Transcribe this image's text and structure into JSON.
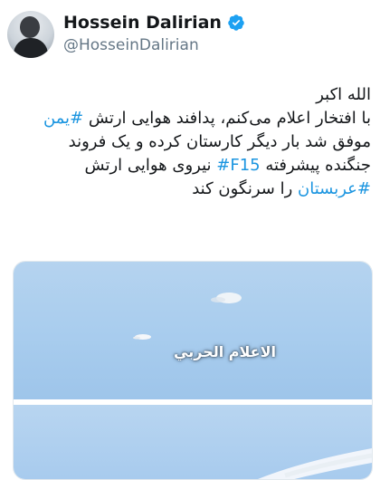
{
  "profile": {
    "name": "Hossein Dalirian",
    "handle": "@HosseinDalirian",
    "verified_icon": "verified-badge-icon",
    "verified_color": "#1da1f2"
  },
  "tweet": {
    "line1": "الله اکبر",
    "line2_text": "با افتخار اعلام می‌کنم، پدافند هوایی ارتش ",
    "line2_tag": "#یمن",
    "line3": "موفق شد بار دیگر کارستان کرده و یک فروند",
    "line4_text_a": "جنگنده پیشرفته ",
    "line4_tag": "#F15",
    "line4_text_b": " نیروی هوایی ارتش",
    "line5_tag": "#عربستان",
    "line5_text": " را سرنگون کند",
    "hashtag_color": "#1b95e0"
  },
  "media": {
    "overlay_text": "الاعلام الحربي"
  }
}
